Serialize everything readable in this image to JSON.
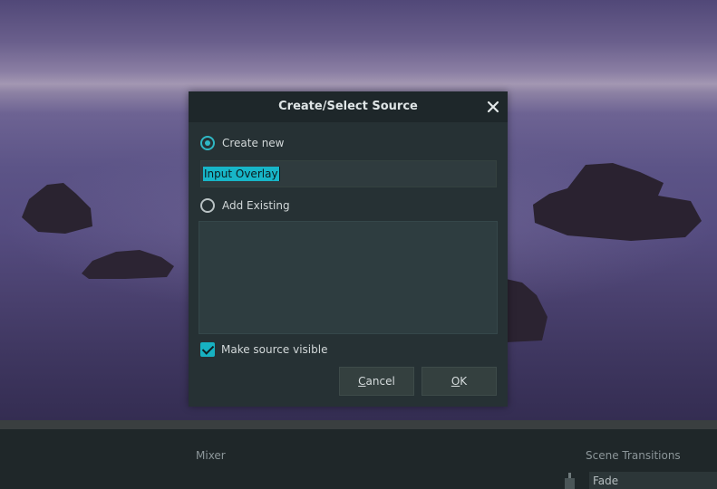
{
  "dialog": {
    "title": "Create/Select Source",
    "create_new_label": "Create new",
    "create_new_selected": true,
    "source_name_value": "Input Overlay",
    "add_existing_label": "Add Existing",
    "add_existing_selected": false,
    "existing_sources": [],
    "make_visible_label": "Make source visible",
    "make_visible_checked": true,
    "cancel_mnemonic": "C",
    "cancel_rest": "ancel",
    "ok_mnemonic": "O",
    "ok_rest": "K",
    "close_icon": "close-icon"
  },
  "dock": {
    "mixer_title": "Mixer",
    "scene_transitions_title": "Scene Transitions",
    "transition_selected": "Fade"
  },
  "colors": {
    "accent": "#17b6c8",
    "dialog_bg": "#263134",
    "titlebar_bg": "#1e272a",
    "dock_bg": "#1f2729"
  }
}
